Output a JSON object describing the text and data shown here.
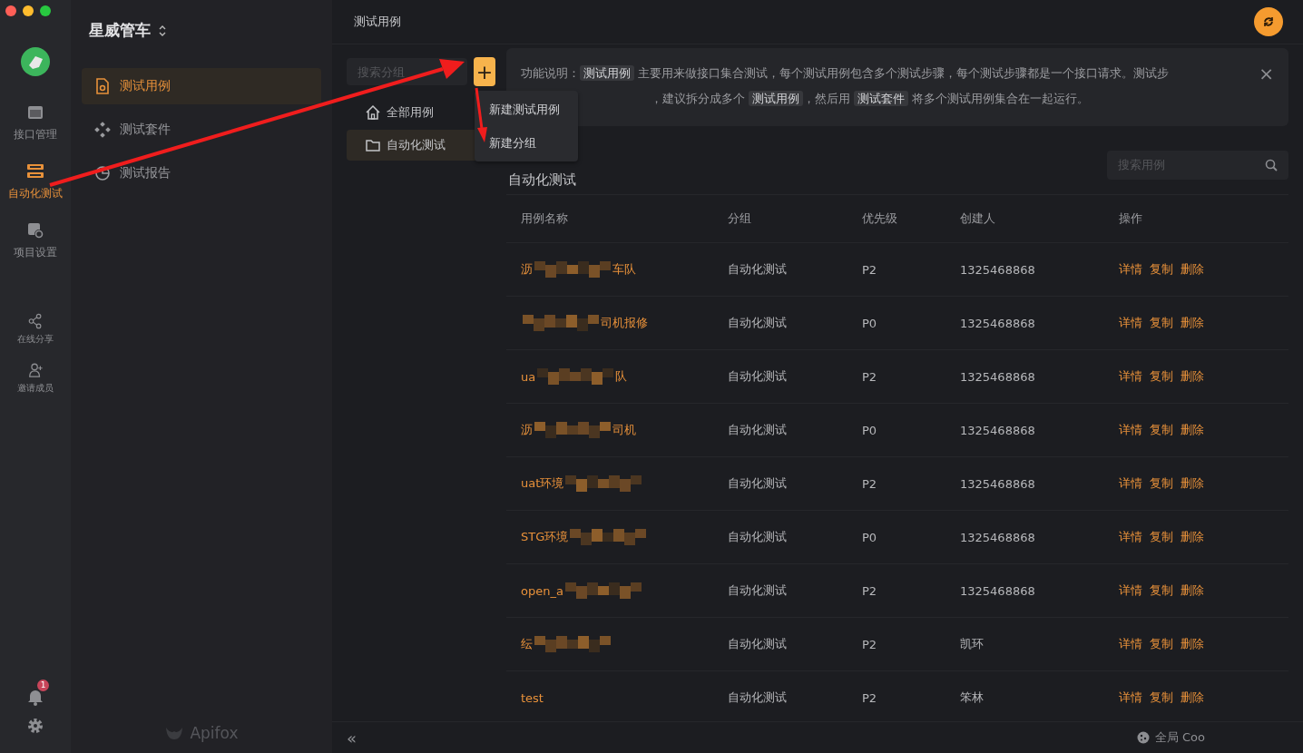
{
  "window": {
    "title": "测试用例"
  },
  "rail": {
    "items": [
      {
        "label": "接口管理",
        "selected": false
      },
      {
        "label": "自动化测试",
        "selected": true
      },
      {
        "label": "项目设置",
        "selected": false
      }
    ],
    "extra_items": [
      "在线分享",
      "邀请成员"
    ],
    "notification_badge": "1"
  },
  "sidebar": {
    "project": "星威管车",
    "items": [
      {
        "label": "测试用例",
        "selected": true
      },
      {
        "label": "测试套件",
        "selected": false
      },
      {
        "label": "测试报告",
        "selected": false
      }
    ],
    "brand": "Apifox"
  },
  "groups": {
    "search": {
      "placeholder": "搜索分组"
    },
    "add_button": "+",
    "items": [
      {
        "label": "全部用例",
        "selected": false,
        "kind": "home"
      },
      {
        "label": "自动化测试",
        "selected": true,
        "kind": "folder"
      }
    ]
  },
  "add_menu": [
    "新建测试用例",
    "新建分组"
  ],
  "banner": {
    "lines": [
      [
        {
          "kind": "plain",
          "text": "功能说明："
        },
        {
          "kind": "code",
          "text": "测试用例"
        },
        {
          "kind": "plain",
          "text": " 主要用来做接口集合测试，每个测试用例包含多个测试步骤，每个测试步骤都是一个接口请求。测试步"
        }
      ],
      [
        {
          "kind": "plain",
          "text": "，建议拆分成多个 "
        },
        {
          "kind": "code",
          "text": "测试用例"
        },
        {
          "kind": "plain",
          "text": "，然后用 "
        },
        {
          "kind": "code",
          "text": "测试套件"
        },
        {
          "kind": "plain",
          "text": " 将多个测试用例集合在一起运行。"
        }
      ]
    ],
    "close": "×"
  },
  "list": {
    "heading": "自动化测试",
    "search": {
      "placeholder": "搜索用例"
    },
    "columns": [
      "用例名称",
      "分组",
      "优先级",
      "创建人",
      "操作"
    ],
    "rows": [
      {
        "name_start": "沥",
        "name_end": "车队",
        "redacted": true,
        "group": "自动化测试",
        "priority": "P2",
        "creator": "1325468868",
        "actions": [
          "详情",
          "复制",
          "删除"
        ]
      },
      {
        "name_end": "司机报修",
        "redacted": true,
        "group": "自动化测试",
        "priority": "P0",
        "creator": "1325468868",
        "actions": [
          "详情",
          "复制",
          "删除"
        ]
      },
      {
        "name_start": "ua",
        "name_end": "队",
        "redacted": true,
        "group": "自动化测试",
        "priority": "P2",
        "creator": "1325468868",
        "actions": [
          "详情",
          "复制",
          "删除"
        ]
      },
      {
        "name_start": "沥",
        "name_end": "司机",
        "redacted": true,
        "group": "自动化测试",
        "priority": "P0",
        "creator": "1325468868",
        "actions": [
          "详情",
          "复制",
          "删除"
        ]
      },
      {
        "name_start": "uat环境",
        "redacted": true,
        "group": "自动化测试",
        "priority": "P2",
        "creator": "1325468868",
        "actions": [
          "详情",
          "复制",
          "删除"
        ]
      },
      {
        "name_start": "STG环境",
        "redacted": true,
        "group": "自动化测试",
        "priority": "P0",
        "creator": "1325468868",
        "actions": [
          "详情",
          "复制",
          "删除"
        ]
      },
      {
        "name_start": "open_a",
        "redacted": true,
        "group": "自动化测试",
        "priority": "P2",
        "creator": "1325468868",
        "actions": [
          "详情",
          "复制",
          "删除"
        ]
      },
      {
        "name_start": "纭",
        "redacted": true,
        "group": "自动化测试",
        "priority": "P2",
        "creator": "凯环",
        "actions": [
          "详情",
          "复制",
          "删除"
        ]
      },
      {
        "name_start": "test",
        "redacted": false,
        "group": "自动化测试",
        "priority": "P2",
        "creator": "笨林",
        "actions": [
          "详情",
          "复制",
          "删除"
        ]
      }
    ]
  },
  "footer": {
    "collapse": "«",
    "cookie": "全局 Coo"
  }
}
